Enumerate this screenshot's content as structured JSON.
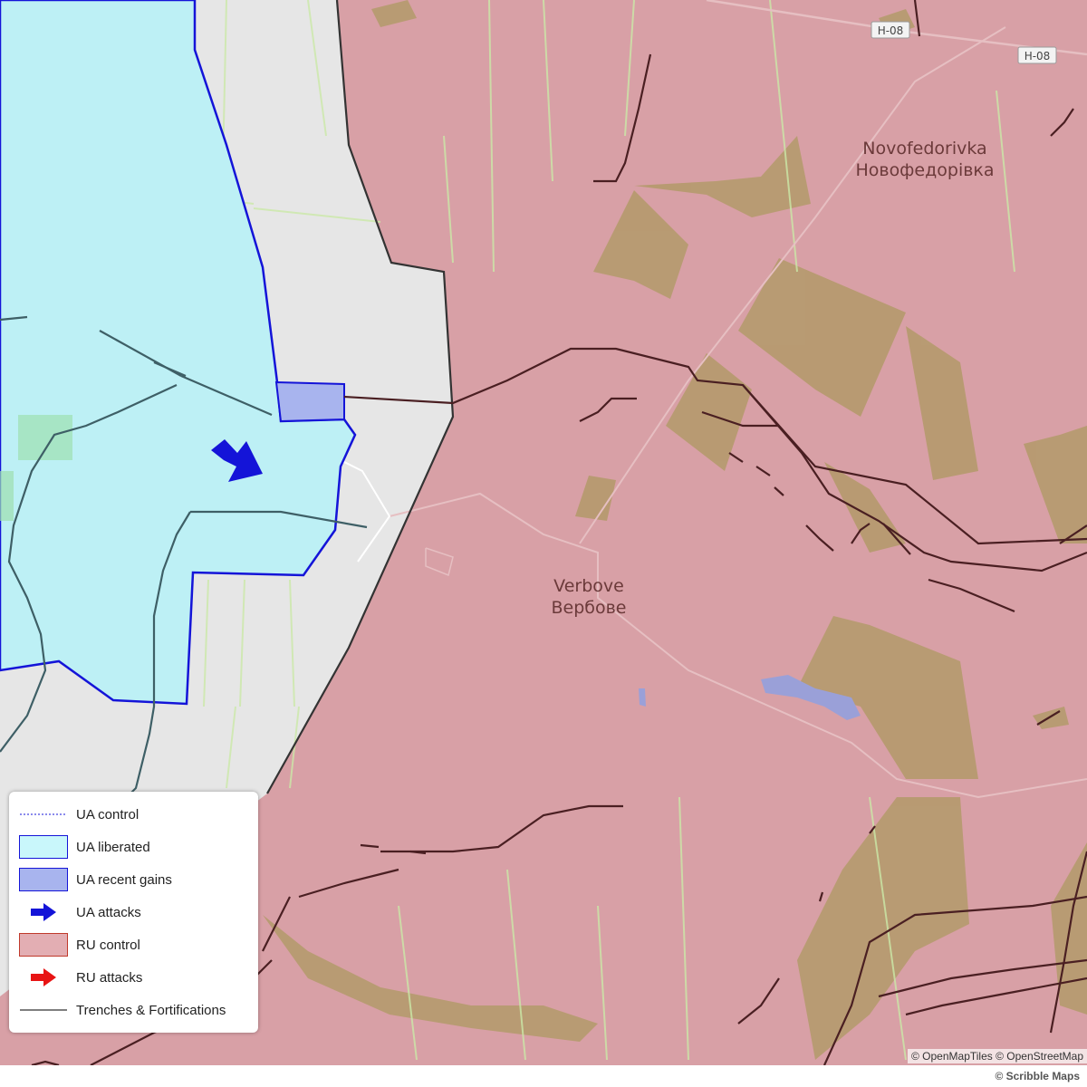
{
  "map": {
    "places": [
      {
        "id": "novofedorivka",
        "latin": "Novofedorivka",
        "cyrillic": "Новофедорівка"
      },
      {
        "id": "verbove",
        "latin": "Verbove",
        "cyrillic": "Вербове"
      }
    ],
    "roads": [
      {
        "label": "H-08"
      },
      {
        "label": "H-08"
      }
    ],
    "colors": {
      "ua_liberated": "#bdf0f5",
      "ua_recent_gains": "#a8b4ee",
      "ua_border": "#1414d8",
      "ru_control": "#d8a0a6",
      "terrain_forest": "#b39a6a",
      "trench": "#4a1f22",
      "neutral": "#e6e6e6"
    }
  },
  "legend": {
    "items": [
      {
        "label": "UA control",
        "icon": "dashed-line-icon"
      },
      {
        "label": "UA liberated",
        "icon": "cyan-area-swatch"
      },
      {
        "label": "UA recent gains",
        "icon": "blue-area-swatch"
      },
      {
        "label": "UA attacks",
        "icon": "blue-arrow-icon"
      },
      {
        "label": "RU control",
        "icon": "red-area-swatch"
      },
      {
        "label": "RU attacks",
        "icon": "red-arrow-icon"
      },
      {
        "label": "Trenches & Fortifications",
        "icon": "solid-line-icon"
      }
    ]
  },
  "attribution": "© OpenMapTiles © OpenStreetMap",
  "footer": {
    "brand": "© Scribble Maps"
  }
}
